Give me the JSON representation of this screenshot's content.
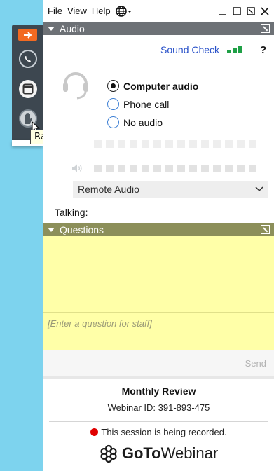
{
  "menu": {
    "file": "File",
    "view": "View",
    "help": "Help"
  },
  "audio": {
    "header": "Audio",
    "sound_check": "Sound Check",
    "help_symbol": "?",
    "options": [
      {
        "label": "Computer audio",
        "selected": true
      },
      {
        "label": "Phone call",
        "selected": false
      },
      {
        "label": "No audio",
        "selected": false
      }
    ],
    "device": "Remote Audio",
    "talking_label": "Talking:"
  },
  "toolbar": {
    "raise_hand_tooltip": "Raise hand"
  },
  "questions": {
    "header": "Questions",
    "placeholder": "[Enter a question for staff]",
    "send_label": "Send"
  },
  "info": {
    "title": "Monthly Review",
    "webinar_id": "Webinar ID: 391-893-475",
    "recording": "This session is being recorded.",
    "brand_bold": "GoTo",
    "brand_regular": "Webinar"
  },
  "colors": {
    "accent_link": "#2a52c9",
    "signal": "#1fa046",
    "recording_dot": "#e00000",
    "questions_bg": "#ffffa8",
    "toolbar_arrow": "#f26a22"
  },
  "icons": [
    "arrow-right-icon",
    "phone-icon",
    "window-icon",
    "hand-icon",
    "globe-icon",
    "headset-icon",
    "speaker-icon",
    "gotowebinar-logo-icon"
  ]
}
